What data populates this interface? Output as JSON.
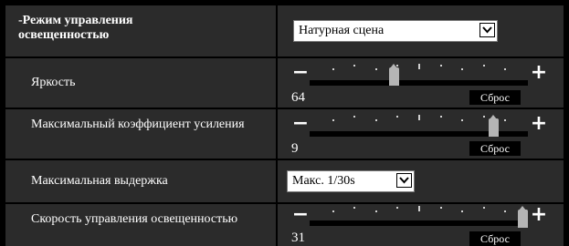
{
  "rows": [
    {
      "label": "-Режим управления освещенностью",
      "type": "select",
      "value": "Натурная сцена"
    },
    {
      "label": "Яркость",
      "type": "slider",
      "value": "64",
      "level_fraction": 0.38,
      "reset": "Сброс"
    },
    {
      "label": "Максимальный коэффициент усиления",
      "type": "slider",
      "value": "9",
      "level_fraction": 0.86,
      "reset": "Сброс"
    },
    {
      "label": "Максимальная выдержка",
      "type": "select",
      "value": "Макс. 1/30s"
    },
    {
      "label": "Скорость управления освещенностью",
      "type": "slider",
      "value": "31",
      "level_fraction": 1.0,
      "reset": "Сброс"
    }
  ],
  "slider_minus": "−",
  "slider_plus": "+",
  "colors": {
    "row_bg": "#2b2b2b",
    "thumb": "#b5b5b5",
    "page_bg": "#000000"
  },
  "icons": {
    "dropdown": "chevron-down-icon"
  }
}
